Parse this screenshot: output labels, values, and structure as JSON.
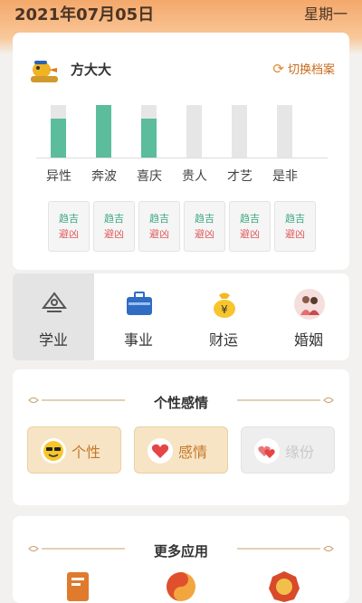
{
  "header": {
    "date": "2021年07月05日",
    "weekday": "星期一"
  },
  "profile": {
    "name": "方大大",
    "switch_label": "切换档案"
  },
  "fortune_bars": [
    {
      "label": "异性",
      "level": 0.75
    },
    {
      "label": "奔波",
      "level": 1.0
    },
    {
      "label": "喜庆",
      "level": 0.75
    },
    {
      "label": "贵人",
      "level": 0
    },
    {
      "label": "才艺",
      "level": 0
    },
    {
      "label": "是非",
      "level": 0
    }
  ],
  "tags": [
    {
      "good": "趋吉",
      "bad": "避凶"
    },
    {
      "good": "趋吉",
      "bad": "避凶"
    },
    {
      "good": "趋吉",
      "bad": "避凶"
    },
    {
      "good": "趋吉",
      "bad": "避凶"
    },
    {
      "good": "趋吉",
      "bad": "避凶"
    },
    {
      "good": "趋吉",
      "bad": "避凶"
    }
  ],
  "tabs": [
    {
      "label": "学业",
      "icon": "graduation-cap-icon"
    },
    {
      "label": "事业",
      "icon": "briefcase-icon"
    },
    {
      "label": "财运",
      "icon": "money-bag-icon"
    },
    {
      "label": "婚姻",
      "icon": "couple-icon"
    }
  ],
  "personality": {
    "title": "个性感情",
    "items": [
      {
        "label": "个性",
        "icon": "sunglasses-face-icon"
      },
      {
        "label": "感情",
        "icon": "heart-icon"
      },
      {
        "label": "缘份",
        "icon": "double-heart-icon"
      }
    ]
  },
  "more_apps": {
    "title": "更多应用"
  },
  "colors": {
    "accent": "#f4a86b",
    "bar": "#5bbd9c",
    "good": "#3ea880",
    "bad": "#e05a5a"
  }
}
